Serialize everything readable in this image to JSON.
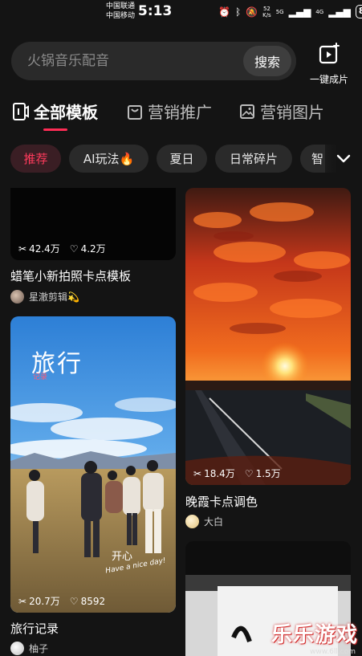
{
  "status_bar": {
    "carrier1": "中国联通",
    "carrier2": "中国移动",
    "time": "5:13",
    "net_speed_top": "52",
    "net_speed_bottom": "K/s",
    "signal1": "5G",
    "signal2": "4G",
    "battery": "81"
  },
  "search": {
    "placeholder": "火锅音乐配音",
    "button_label": "搜索"
  },
  "one_click": {
    "label": "一键成片",
    "icon": "video-plus-icon"
  },
  "tabs": [
    {
      "label": "全部模板",
      "icon": "phone-template-icon",
      "active": true
    },
    {
      "label": "营销推广",
      "icon": "bag-icon",
      "active": false
    },
    {
      "label": "营销图片",
      "icon": "image-icon",
      "active": false
    }
  ],
  "chips": [
    {
      "label": "推荐",
      "active": true
    },
    {
      "label": "AI玩法🔥",
      "active": false
    },
    {
      "label": "夏日",
      "active": false
    },
    {
      "label": "日常碎片",
      "active": false
    },
    {
      "label": "智",
      "active": false
    }
  ],
  "cards": [
    {
      "plays": "42.4万",
      "likes": "4.2万",
      "title": "蜡笔小新拍照卡点模板",
      "author": "星澈剪辑💫"
    },
    {
      "plays": "20.7万",
      "likes": "8592",
      "title": "旅行记录",
      "author": "柚子",
      "overlay_title": "旅行",
      "overlay_sub": "记录",
      "overlay_caption": "开心",
      "overlay_caption2": "Have a nice day!"
    },
    {
      "plays": "18.4万",
      "likes": "1.5万",
      "title": "晚霞卡点调色",
      "author": "大白"
    },
    {
      "plays": "",
      "likes": "",
      "title": "",
      "author": ""
    }
  ],
  "watermark": {
    "text": "乐乐游戏",
    "url": "www.6ll.com"
  },
  "colors": {
    "background": "#141414",
    "accent": "#fe2c55",
    "chip_bg": "#2a2a2a"
  }
}
